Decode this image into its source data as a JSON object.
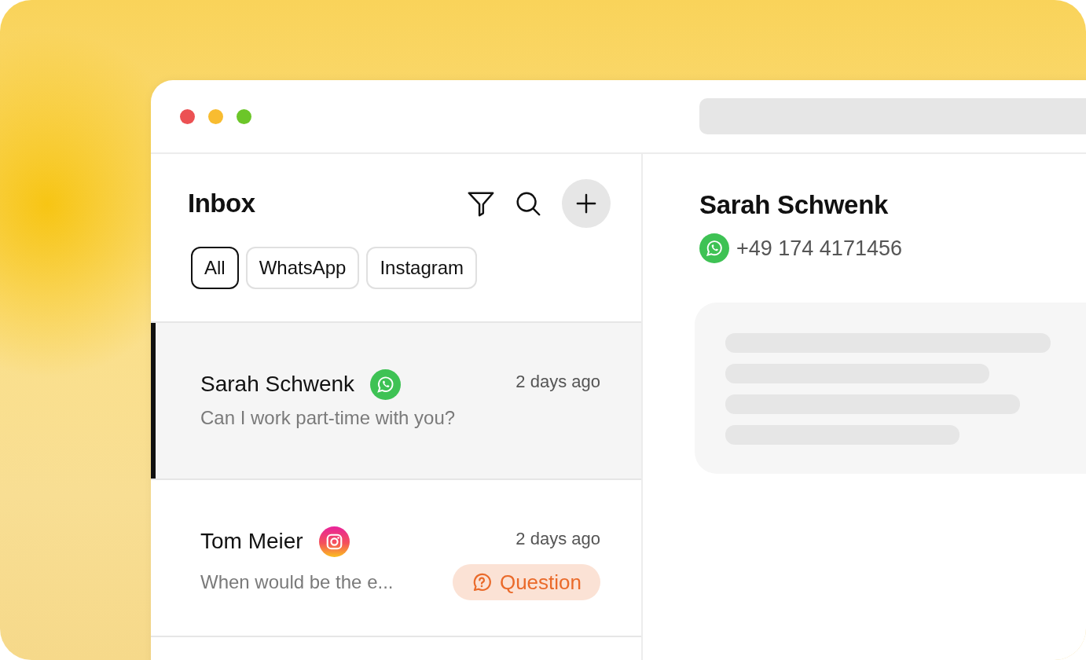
{
  "inbox": {
    "title": "Inbox",
    "filters": [
      {
        "label": "All",
        "selected": true
      },
      {
        "label": "WhatsApp",
        "selected": false
      },
      {
        "label": "Instagram",
        "selected": false
      }
    ],
    "conversations": [
      {
        "name": "Sarah Schwenk",
        "channel": {
          "kind": "whatsapp"
        },
        "time": "2 days ago",
        "preview": "Can I work part-time with you?",
        "selected": true
      },
      {
        "name": "Tom Meier",
        "channel": {
          "kind": "instagram"
        },
        "time": "2 days ago",
        "preview": "When would be the e...",
        "selected": false,
        "tag": {
          "kind": "question",
          "label": "Question"
        }
      }
    ]
  },
  "contact": {
    "name": "Sarah Schwenk",
    "channel": {
      "kind": "whatsapp"
    },
    "phone": "+49 174 4171456"
  }
}
